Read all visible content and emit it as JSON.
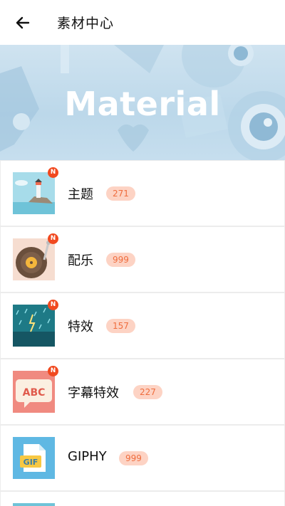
{
  "header": {
    "title": "素材中心",
    "back_icon": "arrow-left-icon"
  },
  "banner": {
    "title": "Material"
  },
  "items": [
    {
      "label": "主题",
      "count": "271",
      "new_badge": "N",
      "icon": "lighthouse-thumbnail-icon"
    },
    {
      "label": "配乐",
      "count": "999",
      "new_badge": "N",
      "icon": "vinyl-record-thumbnail-icon"
    },
    {
      "label": "特效",
      "count": "157",
      "new_badge": "N",
      "icon": "rain-lightning-thumbnail-icon"
    },
    {
      "label": "字幕特效",
      "count": "227",
      "new_badge": "N",
      "icon": "abc-speech-bubble-thumbnail-icon"
    },
    {
      "label": "GIPHY",
      "count": "999",
      "new_badge": "",
      "icon": "gif-file-thumbnail-icon"
    }
  ],
  "colors": {
    "badge": "#f1491f",
    "count_bg": "#fdd3c4",
    "count_text": "#ef6d3e"
  }
}
